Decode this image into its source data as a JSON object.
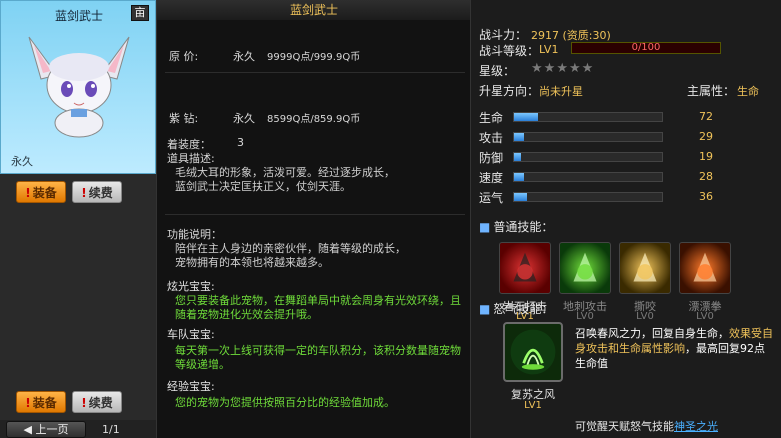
{
  "card": {
    "name": "蓝剑武士",
    "icon_glyph": "亩",
    "duration": "永久"
  },
  "buttons": {
    "equip_label": "装备",
    "renew_label": "续费",
    "exclamation": "!"
  },
  "pager": {
    "prev_label": "上一页",
    "page": "1/1"
  },
  "middle": {
    "title": "蓝剑武士",
    "prices": [
      {
        "label": "原 价:",
        "duration": "永久",
        "amount": "9999Q点/999.9Q币"
      },
      {
        "label": "紫 钻:",
        "duration": "永久",
        "amount": "8599Q点/859.9Q币"
      }
    ],
    "equip_level_label": "着装度：",
    "equip_level_value": "3",
    "item_desc_label": "道具描述:",
    "item_desc": "毛绒大耳的形象，活泼可爱。经过逐步成长，蓝剑武士决定匡扶正义，仗剑天涯。",
    "function_label": "功能说明：",
    "function_desc": "陪伴在主人身边的亲密伙伴，随着等级的成长，宠物拥有的本领也将越来越多。",
    "sections": [
      {
        "title": "炫光宝宝:",
        "text": "您只要装备此宠物，在舞蹈单局中就会周身有光效环绕，且随着宠物进化光效会提升哦。"
      },
      {
        "title": "车队宝宝:",
        "text": "每天第一次上线可获得一定的车队积分，该积分数量随宠物等级递增。"
      },
      {
        "title": "经验宝宝:",
        "text": "您的宠物为您提供按照百分比的经验值加成。"
      }
    ]
  },
  "right": {
    "power_label": "战斗力：",
    "power_value": "2917 (资质:30)",
    "level_label": "战斗等级：",
    "level_value": "LV1",
    "level_progress": "0/100",
    "level_progress_fraction": 0,
    "star_label": "星级：",
    "stars_filled": 0,
    "stars_total": 5,
    "upgrade_label": "升星方向：",
    "upgrade_value": "尚未升星",
    "main_attr_label": "主属性：",
    "main_attr_value": "生命",
    "stats": [
      {
        "label": "生命",
        "value": "72",
        "fraction": 0.16
      },
      {
        "label": "攻击",
        "value": "29",
        "fraction": 0.07
      },
      {
        "label": "防御",
        "value": "19",
        "fraction": 0.05
      },
      {
        "label": "速度",
        "value": "28",
        "fraction": 0.07
      },
      {
        "label": "运气",
        "value": "36",
        "fraction": 0.09
      }
    ],
    "normal_skills_label": "普通技能：",
    "skills": [
      {
        "name": "岩石打击",
        "level": "LV1",
        "active": true
      },
      {
        "name": "地刺攻击",
        "level": "LV0",
        "active": false
      },
      {
        "name": "撕咬",
        "level": "LV0",
        "active": false
      },
      {
        "name": "漂漂拳",
        "level": "LV0",
        "active": false
      }
    ],
    "rage_label": "怒气技能：",
    "rage": {
      "name": "复苏之风",
      "level": "LV1",
      "desc_white": "召唤春风之力，回复自身生命，",
      "desc_yellow": "效果受自身攻击和生命属性影响",
      "desc_white2": "，最高回复92点生命值"
    },
    "awaken_text": "可觉醒天赋怒气技能",
    "awaken_link": "神圣之光"
  },
  "colors": {
    "gold": "#f0c35a",
    "green": "#6fdc3a",
    "bar_blue": "#2a7fd8",
    "card_bg": "#9fe0f8"
  }
}
